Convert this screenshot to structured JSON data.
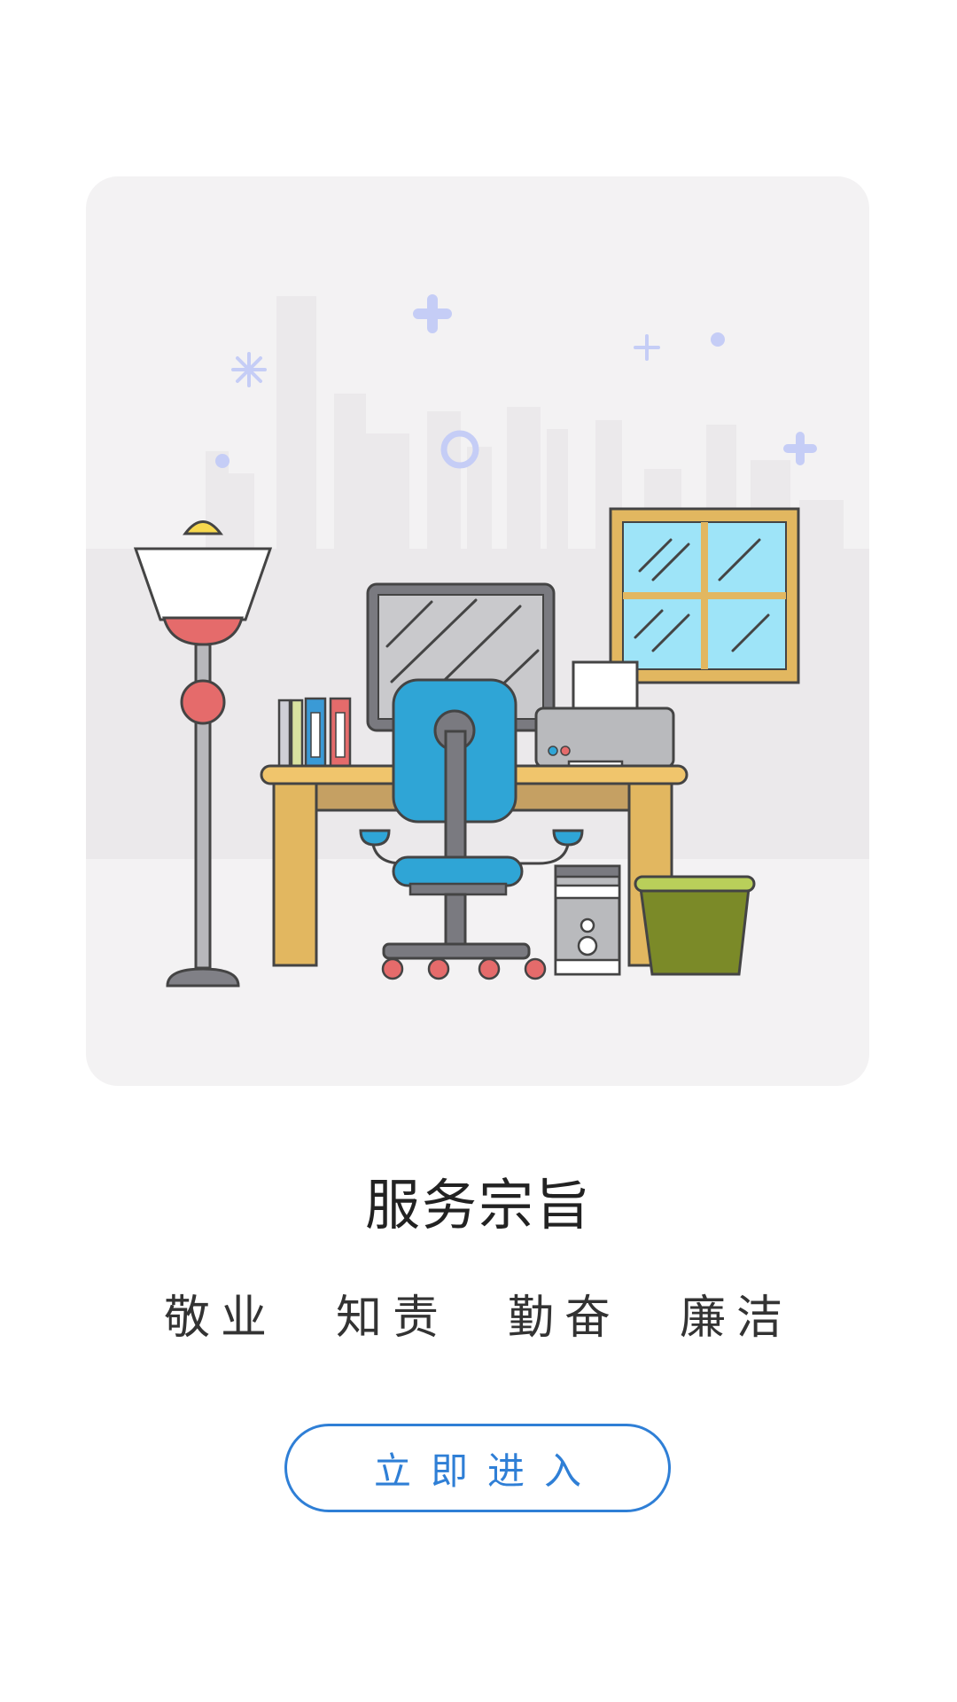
{
  "splash": {
    "title": "服务宗旨",
    "values": [
      "敬业",
      "知责",
      "勤奋",
      "廉洁"
    ],
    "enter_button": "立即进入"
  },
  "colors": {
    "accent": "#2f7fd6",
    "card_background": "#f3f2f3",
    "title_text": "#222222"
  },
  "illustration": {
    "subject": "office desk with computer monitor, chair, printer, binders, floor lamp, window, PC tower and trash bin in front of a city skyline",
    "icons": [
      "floor-lamp-icon",
      "monitor-icon",
      "office-chair-icon",
      "printer-icon",
      "binders-icon",
      "window-icon",
      "pc-tower-icon",
      "trash-bin-icon",
      "city-skyline-icon",
      "sparkle-icon"
    ]
  }
}
